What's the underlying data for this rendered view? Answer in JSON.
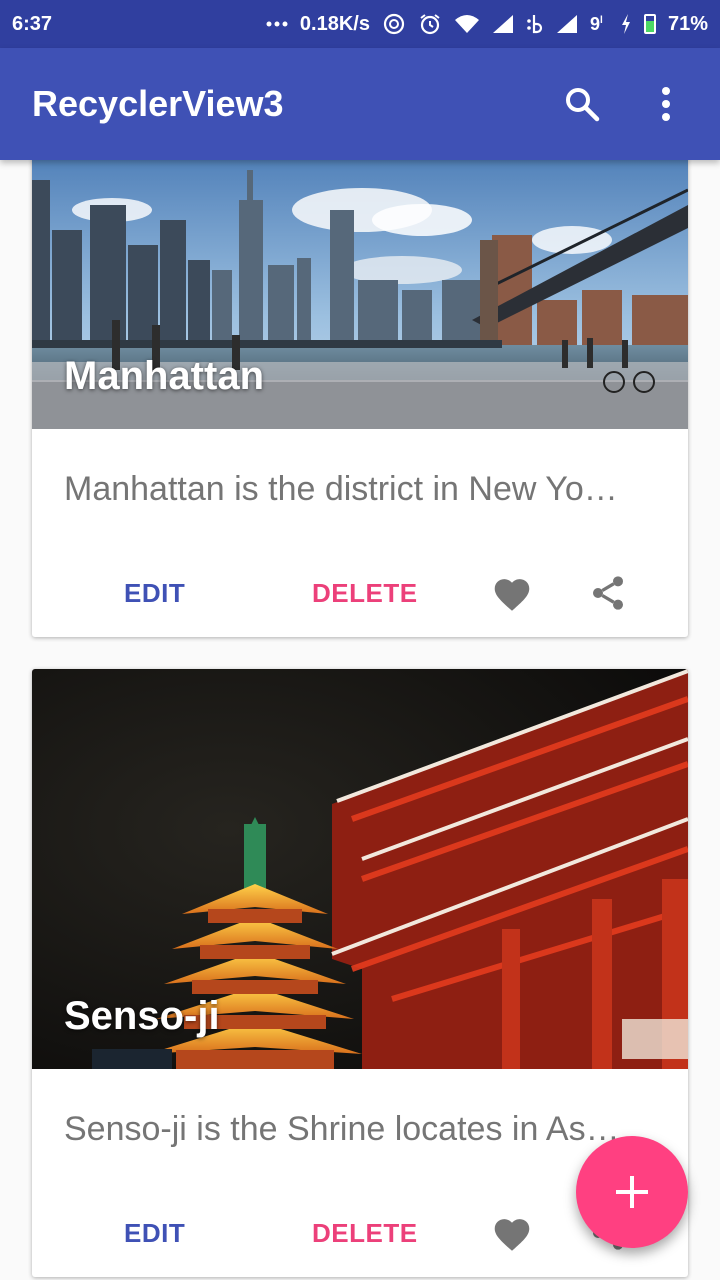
{
  "status_bar": {
    "time": "6:37",
    "net_speed": "0.18K/s",
    "battery": "71%",
    "battery_level": 0.71,
    "icons": [
      "more-dots-icon",
      "sync-icon",
      "alarm-icon",
      "wifi-icon",
      "signal-icon",
      "data-b-icon",
      "signal-icon",
      "carrier-9-icon",
      "charging-bolt-icon",
      "battery-icon"
    ]
  },
  "app_bar": {
    "title": "RecyclerView3",
    "actions": [
      "search-icon",
      "overflow-menu-icon"
    ]
  },
  "cards": [
    {
      "title": "Manhattan",
      "description": "Manhattan is the district in New Yo…",
      "image": "city-skyline-bridge-photo",
      "edit_label": "EDIT",
      "delete_label": "DELETE",
      "icons": [
        "favorite-heart-icon",
        "share-icon"
      ]
    },
    {
      "title": "Senso-ji",
      "description": "Senso-ji is the Shrine locates in As…",
      "image": "temple-pagoda-night-photo",
      "edit_label": "EDIT",
      "delete_label": "DELETE",
      "icons": [
        "favorite-heart-icon",
        "share-icon"
      ]
    }
  ],
  "fab": {
    "icon": "add-icon"
  },
  "colors": {
    "primary": "#3f51b5",
    "primary_dark": "#303f9f",
    "accent": "#ff4081",
    "edit": "#3f51b5",
    "delete": "#ec407a",
    "icon_gray": "#757575"
  }
}
